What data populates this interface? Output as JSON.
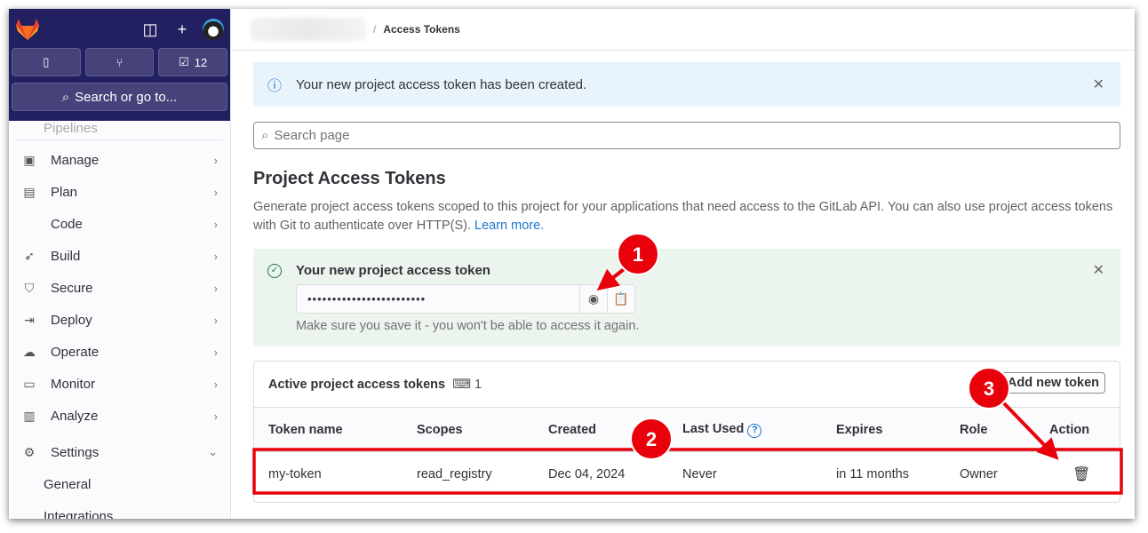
{
  "sidebar": {
    "todo_count": "12",
    "search_label": "Search or go to...",
    "partial_item": "Pipelines",
    "items": [
      {
        "label": "Manage",
        "icon": "briefcase-icon"
      },
      {
        "label": "Plan",
        "icon": "calendar-icon"
      },
      {
        "label": "Code",
        "icon": "code-icon"
      },
      {
        "label": "Build",
        "icon": "rocket-icon"
      },
      {
        "label": "Secure",
        "icon": "shield-icon"
      },
      {
        "label": "Deploy",
        "icon": "deploy-icon"
      },
      {
        "label": "Operate",
        "icon": "cloud-icon"
      },
      {
        "label": "Monitor",
        "icon": "monitor-icon"
      },
      {
        "label": "Analyze",
        "icon": "chart-icon"
      },
      {
        "label": "Settings",
        "icon": "gear-icon"
      }
    ],
    "sub_items": [
      "General",
      "Integrations"
    ]
  },
  "breadcrumb": {
    "current": "Access Tokens"
  },
  "alert": {
    "message": "Your new project access token has been created."
  },
  "search": {
    "placeholder": "Search page"
  },
  "page": {
    "title": "Project Access Tokens",
    "description": "Generate project access tokens scoped to this project for your applications that need access to the GitLab API. You can also use project access tokens with Git to authenticate over HTTP(S).",
    "learn_more": "Learn more."
  },
  "new_token": {
    "title": "Your new project access token",
    "masked_value": "••••••••••••••••••••••••",
    "hint": "Make sure you save it - you won't be able to access it again."
  },
  "tokens": {
    "title": "Active project access tokens",
    "count": "1",
    "add_button": "Add new token",
    "columns": [
      "Token name",
      "Scopes",
      "Created",
      "Last Used",
      "Expires",
      "Role",
      "Action"
    ],
    "rows": [
      {
        "name": "my-token",
        "scopes": "read_registry",
        "created": "Dec 04, 2024",
        "last_used": "Never",
        "expires": "in 11 months",
        "role": "Owner"
      }
    ]
  },
  "annotations": [
    "1",
    "2",
    "3"
  ],
  "colors": {
    "sidebar_top": "#222061",
    "annotation_red": "#e8000b",
    "info_bg": "#e9f3fc",
    "success_bg": "#ecf4ee"
  }
}
